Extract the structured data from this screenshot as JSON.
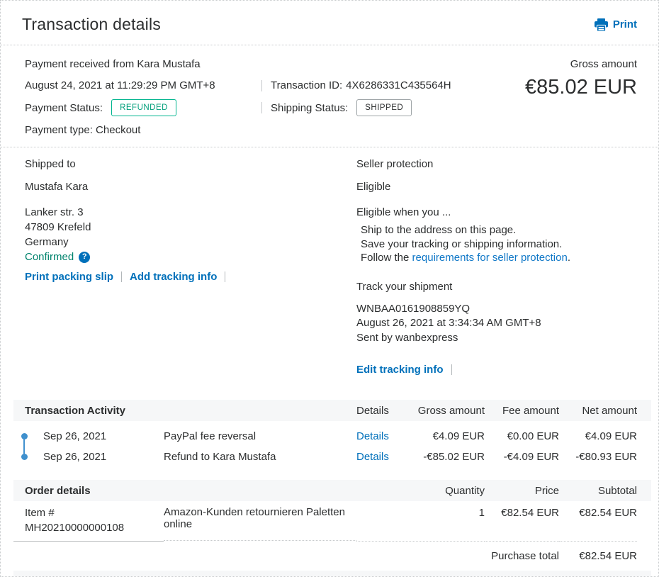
{
  "colors": {
    "link_blue": "#0070ba",
    "success_teal": "#00b48e",
    "confirmed_green": "#00836d",
    "timeline_blue": "#3f90cd",
    "table_header_bg": "#f6f7f8",
    "text_dark": "#2c2e2f"
  },
  "header": {
    "title": "Transaction details",
    "print_label": "Print"
  },
  "payment": {
    "received_from": "Payment received from Kara Mustafa",
    "gross_amount_label": "Gross amount",
    "gross_amount": "€85.02 EUR",
    "date": "August 24, 2021 at 11:29:29 PM GMT+8",
    "transaction_id_label": "Transaction ID:",
    "transaction_id": "4X6286331C435564H",
    "payment_status_label": "Payment Status:",
    "payment_status_value": "REFUNDED",
    "shipping_status_label": "Shipping Status:",
    "shipping_status_value": "SHIPPED",
    "payment_type": "Payment type: Checkout"
  },
  "shipped_to": {
    "title": "Shipped to",
    "name": "Mustafa Kara",
    "address_line1": "Lanker str. 3",
    "address_line2": "47809 Krefeld",
    "address_line3": "Germany",
    "confirmed_label": "Confirmed",
    "help_icon_glyph": "?",
    "print_packing_slip_link": "Print packing slip",
    "add_tracking_info_link": "Add tracking info"
  },
  "seller_protection": {
    "title": "Seller protection",
    "status": "Eligible",
    "subtitle": "Eligible when you ...",
    "condition1": "Ship to the address on this page.",
    "condition2": "Save your tracking or shipping information.",
    "condition3_prefix": "Follow the ",
    "condition3_link": "requirements for seller protection",
    "condition3_suffix": "."
  },
  "tracking": {
    "title": "Track your shipment",
    "number": "WNBAA0161908859YQ",
    "date": "August 26, 2021 at 3:34:34 AM GMT+8",
    "carrier": "Sent by wanbexpress",
    "edit_link": "Edit tracking info"
  },
  "activity": {
    "title": "Transaction Activity",
    "col_details": "Details",
    "col_gross": "Gross amount",
    "col_fee": "Fee amount",
    "col_net": "Net amount",
    "rows": [
      {
        "date": "Sep 26, 2021",
        "description": "PayPal fee reversal",
        "details_link": "Details",
        "gross": "€4.09 EUR",
        "fee": "€0.00 EUR",
        "net": "€4.09 EUR"
      },
      {
        "date": "Sep 26, 2021",
        "description": "Refund to Kara Mustafa",
        "details_link": "Details",
        "gross": "-€85.02 EUR",
        "fee": "-€4.09 EUR",
        "net": "-€80.93 EUR"
      }
    ]
  },
  "order": {
    "title": "Order details",
    "col_quantity": "Quantity",
    "col_price": "Price",
    "col_subtotal": "Subtotal",
    "rows": [
      {
        "item_label": "Item #",
        "item_number": "MH20210000000108",
        "name": "Amazon-Kunden retournieren Paletten online",
        "quantity": "1",
        "price": "€82.54 EUR",
        "subtotal": "€82.54 EUR"
      }
    ],
    "purchase_total_label": "Purchase total",
    "purchase_total": "€82.54 EUR"
  }
}
